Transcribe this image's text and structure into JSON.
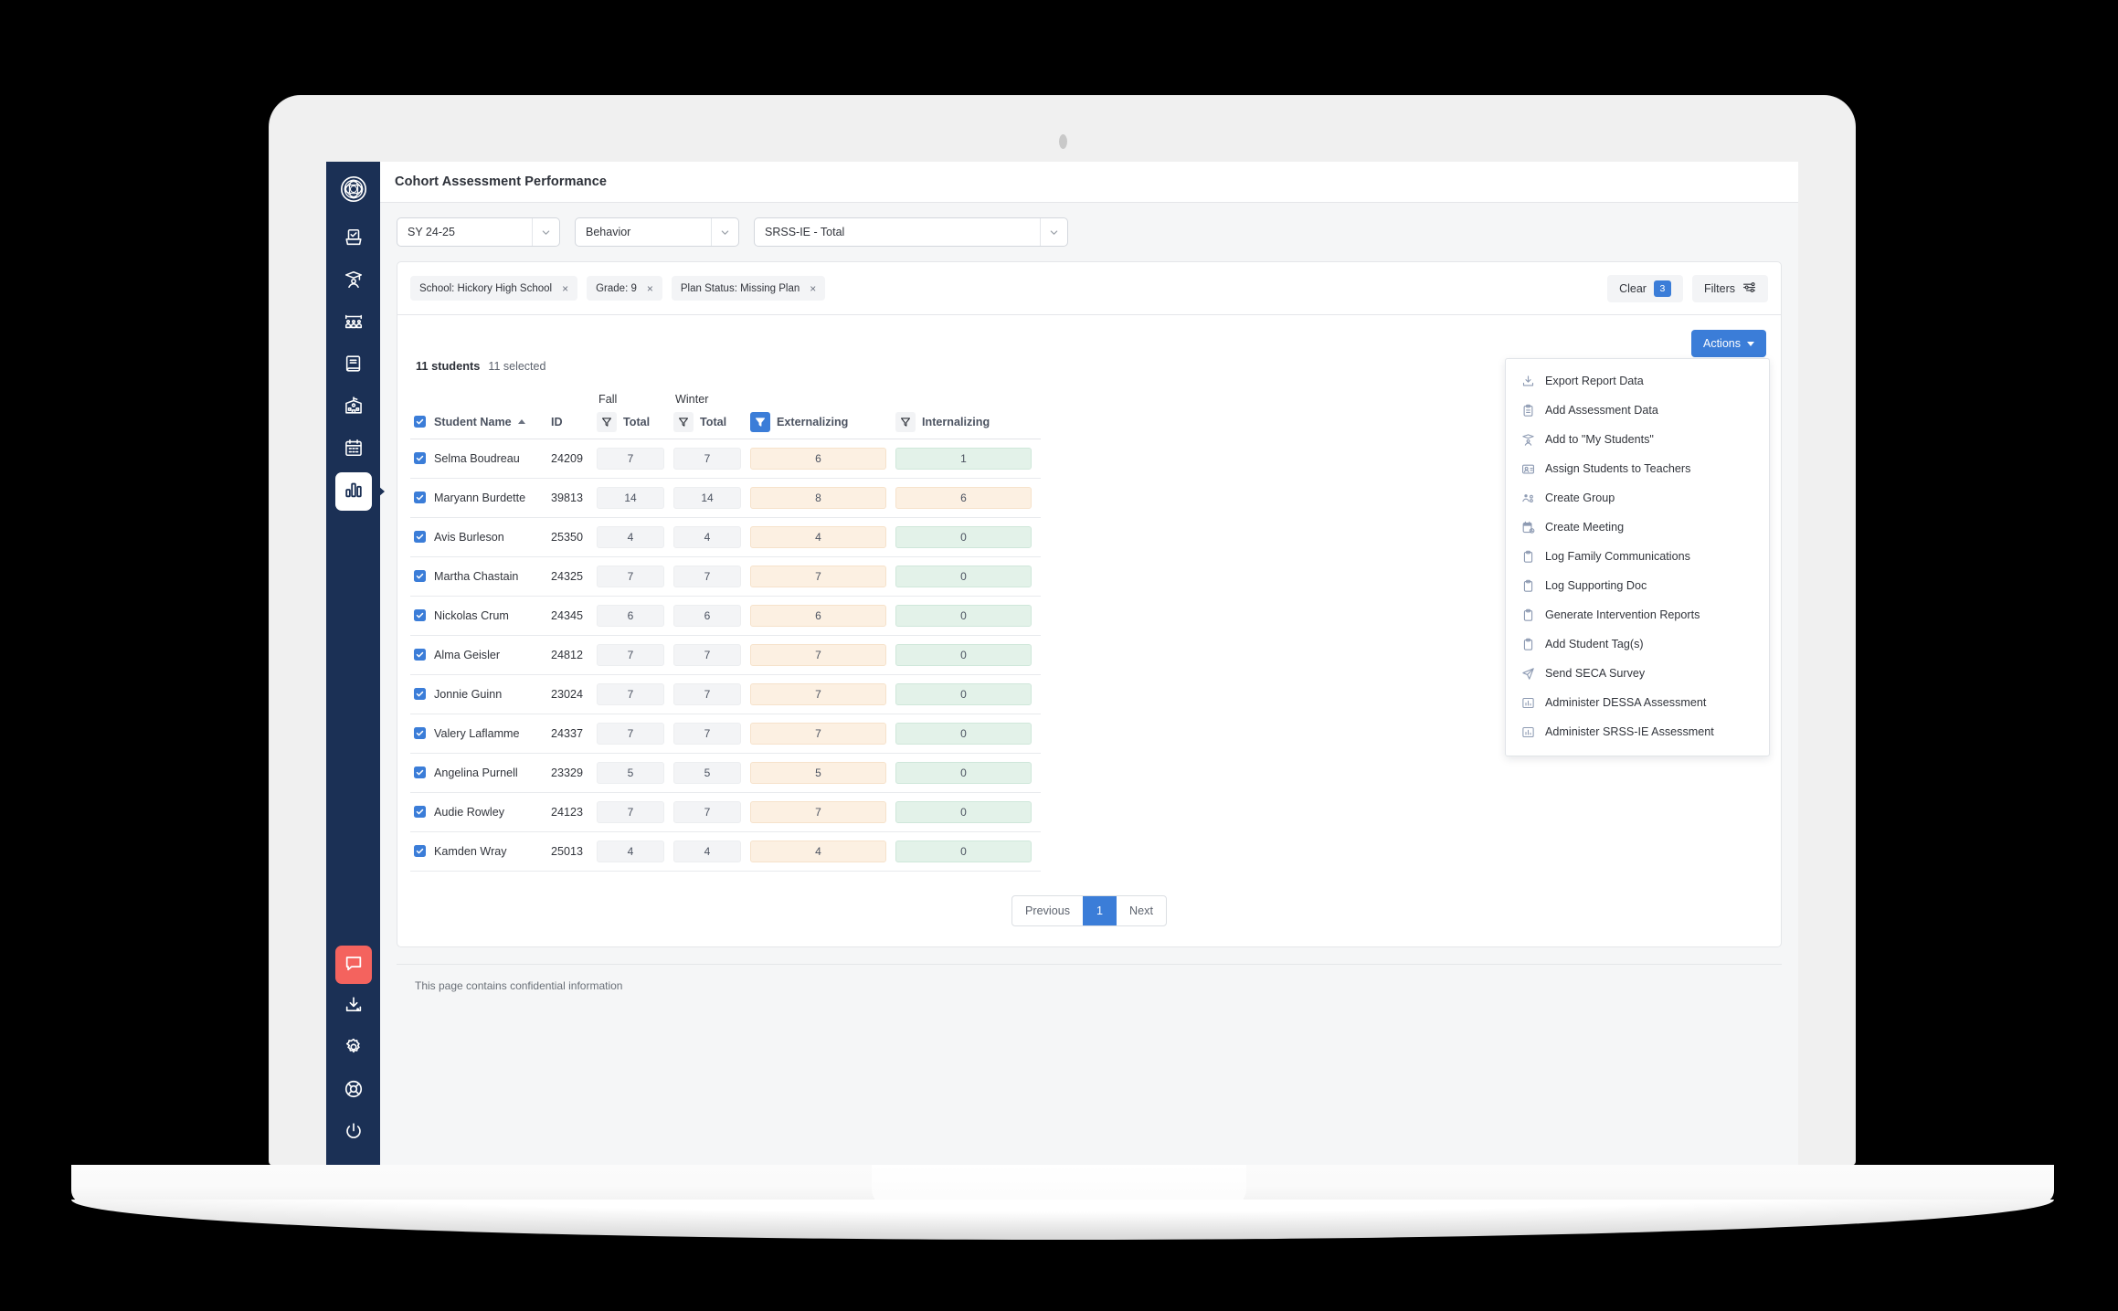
{
  "app": {
    "title": "Cohort Assessment Performance",
    "logo_icon": "geometric-circle-logo"
  },
  "sidebar": {
    "items": [
      {
        "icon": "assessment-checkbox-icon",
        "name": "assessments",
        "active": false
      },
      {
        "icon": "graduate-student-icon",
        "name": "students",
        "active": false
      },
      {
        "icon": "classroom-group-icon",
        "name": "groups",
        "active": false
      },
      {
        "icon": "book-icon",
        "name": "curriculum",
        "active": false
      },
      {
        "icon": "school-building-icon",
        "name": "schools",
        "active": false
      },
      {
        "icon": "calendar-icon",
        "name": "calendar",
        "active": false
      },
      {
        "icon": "bar-chart-icon",
        "name": "reports",
        "active": true
      }
    ],
    "bottom_items": [
      {
        "icon": "chat-bubble-icon",
        "name": "messages",
        "alert": true
      },
      {
        "icon": "download-icon",
        "name": "downloads",
        "alert": false
      },
      {
        "icon": "gear-icon",
        "name": "settings",
        "alert": false
      },
      {
        "icon": "lifebuoy-icon",
        "name": "help",
        "alert": false
      },
      {
        "icon": "power-icon",
        "name": "logout",
        "alert": false
      }
    ]
  },
  "selectors": {
    "school_year": {
      "value": "SY 24-25"
    },
    "domain": {
      "value": "Behavior"
    },
    "assessment": {
      "value": "SRSS-IE - Total"
    }
  },
  "filters": {
    "chips": [
      {
        "label": "School: Hickory High School",
        "remove": "×"
      },
      {
        "label": "Grade: 9",
        "remove": "×"
      },
      {
        "label": "Plan Status: Missing Plan",
        "remove": "×"
      }
    ],
    "clear_label": "Clear",
    "clear_count": "3",
    "filters_label": "Filters"
  },
  "toolbar": {
    "actions_label": "Actions",
    "menu_items": [
      {
        "label": "Export Report Data",
        "icon": "download-icon"
      },
      {
        "label": "Add Assessment Data",
        "icon": "clipboard-list-icon"
      },
      {
        "label": "Add to \"My Students\"",
        "icon": "graduate-student-icon"
      },
      {
        "label": "Assign Students to Teachers",
        "icon": "user-card-icon"
      },
      {
        "label": "Create Group",
        "icon": "users-gear-icon"
      },
      {
        "label": "Create Meeting",
        "icon": "calendar-clock-icon"
      },
      {
        "label": "Log Family Communications",
        "icon": "clipboard-icon"
      },
      {
        "label": "Log Supporting Doc",
        "icon": "clipboard-icon"
      },
      {
        "label": "Generate Intervention Reports",
        "icon": "clipboard-icon"
      },
      {
        "label": "Add Student Tag(s)",
        "icon": "clipboard-icon"
      },
      {
        "label": "Send SECA Survey",
        "icon": "paper-plane-icon"
      },
      {
        "label": "Administer DESSA Assessment",
        "icon": "bar-chart-icon"
      },
      {
        "label": "Administer SRSS-IE Assessment",
        "icon": "bar-chart-icon"
      }
    ]
  },
  "table": {
    "count_total": "11 students",
    "count_selected": "11 selected",
    "group_headers": [
      {
        "label": "Fall",
        "span": 1
      },
      {
        "label": "Winter",
        "span": 3
      }
    ],
    "columns": [
      {
        "label": "Student Name",
        "sorted": "asc",
        "filter": false
      },
      {
        "label": "ID",
        "sorted": null,
        "filter": false
      },
      {
        "label": "Total",
        "sorted": null,
        "filter": true,
        "filter_active": false
      },
      {
        "label": "Total",
        "sorted": null,
        "filter": true,
        "filter_active": false
      },
      {
        "label": "Externalizing",
        "sorted": null,
        "filter": true,
        "filter_active": true
      },
      {
        "label": "Internalizing",
        "sorted": null,
        "filter": true,
        "filter_active": false
      }
    ],
    "rows": [
      {
        "checked": true,
        "name": "Selma Boudreau",
        "id": "24209",
        "fall_total": "7",
        "winter_total": "7",
        "externalizing": "6",
        "internalizing": "1",
        "ext_color": "orange",
        "int_color": "green"
      },
      {
        "checked": true,
        "name": "Maryann Burdette",
        "id": "39813",
        "fall_total": "14",
        "winter_total": "14",
        "externalizing": "8",
        "internalizing": "6",
        "ext_color": "orange",
        "int_color": "orange"
      },
      {
        "checked": true,
        "name": "Avis Burleson",
        "id": "25350",
        "fall_total": "4",
        "winter_total": "4",
        "externalizing": "4",
        "internalizing": "0",
        "ext_color": "orange",
        "int_color": "green"
      },
      {
        "checked": true,
        "name": "Martha Chastain",
        "id": "24325",
        "fall_total": "7",
        "winter_total": "7",
        "externalizing": "7",
        "internalizing": "0",
        "ext_color": "orange",
        "int_color": "green"
      },
      {
        "checked": true,
        "name": "Nickolas Crum",
        "id": "24345",
        "fall_total": "6",
        "winter_total": "6",
        "externalizing": "6",
        "internalizing": "0",
        "ext_color": "orange",
        "int_color": "green"
      },
      {
        "checked": true,
        "name": "Alma Geisler",
        "id": "24812",
        "fall_total": "7",
        "winter_total": "7",
        "externalizing": "7",
        "internalizing": "0",
        "ext_color": "orange",
        "int_color": "green"
      },
      {
        "checked": true,
        "name": "Jonnie Guinn",
        "id": "23024",
        "fall_total": "7",
        "winter_total": "7",
        "externalizing": "7",
        "internalizing": "0",
        "ext_color": "orange",
        "int_color": "green"
      },
      {
        "checked": true,
        "name": "Valery Laflamme",
        "id": "24337",
        "fall_total": "7",
        "winter_total": "7",
        "externalizing": "7",
        "internalizing": "0",
        "ext_color": "orange",
        "int_color": "green"
      },
      {
        "checked": true,
        "name": "Angelina Purnell",
        "id": "23329",
        "fall_total": "5",
        "winter_total": "5",
        "externalizing": "5",
        "internalizing": "0",
        "ext_color": "orange",
        "int_color": "green"
      },
      {
        "checked": true,
        "name": "Audie Rowley",
        "id": "24123",
        "fall_total": "7",
        "winter_total": "7",
        "externalizing": "7",
        "internalizing": "0",
        "ext_color": "orange",
        "int_color": "green"
      },
      {
        "checked": true,
        "name": "Kamden Wray",
        "id": "25013",
        "fall_total": "4",
        "winter_total": "4",
        "externalizing": "4",
        "internalizing": "0",
        "ext_color": "orange",
        "int_color": "green"
      }
    ]
  },
  "pagination": {
    "previous": "Previous",
    "current_page": "1",
    "next": "Next"
  },
  "footer": {
    "note": "This page contains confidential information"
  },
  "colors": {
    "sidebar": "#1b3055",
    "accent": "#3b7dd8",
    "alert": "#f4635e",
    "cell_orange_bg": "#fcf0e2",
    "cell_green_bg": "#e3f2e9",
    "cell_neutral_bg": "#f3f4f6"
  }
}
